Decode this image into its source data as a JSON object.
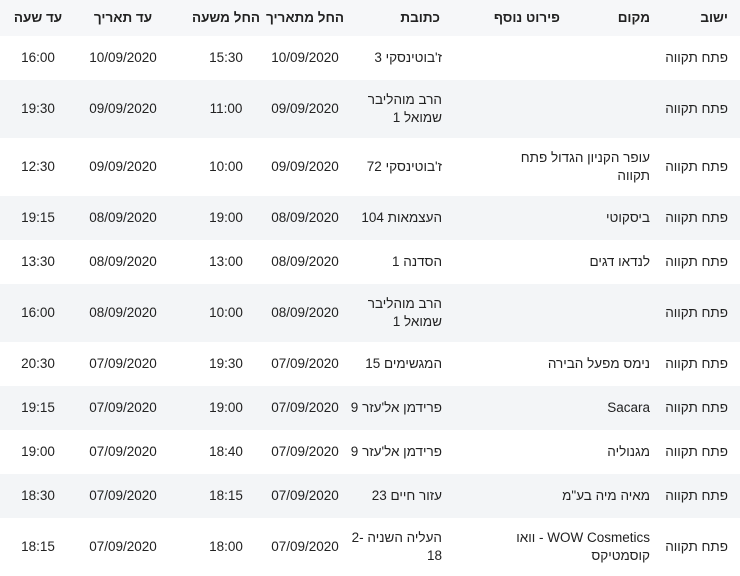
{
  "header": {
    "city": "ישוב",
    "place": "מקום",
    "extra": "פירוט נוסף",
    "address": "כתובת",
    "from_date": "החל מתאריך",
    "from_time": "החל משעה",
    "to_date": "עד תאריך",
    "to_time": "עד שעה"
  },
  "rows": [
    {
      "city": "פתח תקווה",
      "place": "",
      "extra": "",
      "address": "ז'בוטינסקי 3",
      "from_date": "10/09/2020",
      "from_time": "15:30",
      "to_date": "10/09/2020",
      "to_time": "16:00"
    },
    {
      "city": "פתח תקווה",
      "place": "",
      "extra": "",
      "address": "הרב מוהליבר שמואל 1",
      "from_date": "09/09/2020",
      "from_time": "11:00",
      "to_date": "09/09/2020",
      "to_time": "19:30"
    },
    {
      "city": "פתח תקווה",
      "place": "עופר הקניון הגדול פתח תקווה",
      "extra": "",
      "address": "ז'בוטינסקי 72",
      "from_date": "09/09/2020",
      "from_time": "10:00",
      "to_date": "09/09/2020",
      "to_time": "12:30"
    },
    {
      "city": "פתח תקווה",
      "place": "ביסקוטי",
      "extra": "",
      "address": "העצמאות 104",
      "from_date": "08/09/2020",
      "from_time": "19:00",
      "to_date": "08/09/2020",
      "to_time": "19:15"
    },
    {
      "city": "פתח תקווה",
      "place": "לנדאו דגים",
      "extra": "",
      "address": "הסדנה 1",
      "from_date": "08/09/2020",
      "from_time": "13:00",
      "to_date": "08/09/2020",
      "to_time": "13:30"
    },
    {
      "city": "פתח תקווה",
      "place": "",
      "extra": "",
      "address": "הרב מוהליבר שמואל 1",
      "from_date": "08/09/2020",
      "from_time": "10:00",
      "to_date": "08/09/2020",
      "to_time": "16:00"
    },
    {
      "city": "פתח תקווה",
      "place": "נימס מפעל הבירה",
      "extra": "",
      "address": "המגשימים 15",
      "from_date": "07/09/2020",
      "from_time": "19:30",
      "to_date": "07/09/2020",
      "to_time": "20:30"
    },
    {
      "city": "פתח תקווה",
      "place": "Sacara",
      "extra": "",
      "address": "פרידמן אל'עזר 9",
      "from_date": "07/09/2020",
      "from_time": "19:00",
      "to_date": "07/09/2020",
      "to_time": "19:15"
    },
    {
      "city": "פתח תקווה",
      "place": "מגנוליה",
      "extra": "",
      "address": "פרידמן אל'עזר 9",
      "from_date": "07/09/2020",
      "from_time": "18:40",
      "to_date": "07/09/2020",
      "to_time": "19:00"
    },
    {
      "city": "פתח תקווה",
      "place": "מאיה מיה בע\"מ",
      "extra": "",
      "address": "עזור חיים 23",
      "from_date": "07/09/2020",
      "from_time": "18:15",
      "to_date": "07/09/2020",
      "to_time": "18:30"
    },
    {
      "city": "פתח תקווה",
      "place": "WOW Cosmetics - וואו קוסמטיקס",
      "extra": "",
      "address": "העליה השניה 2-18",
      "from_date": "07/09/2020",
      "from_time": "18:00",
      "to_date": "07/09/2020",
      "to_time": "18:15"
    }
  ]
}
